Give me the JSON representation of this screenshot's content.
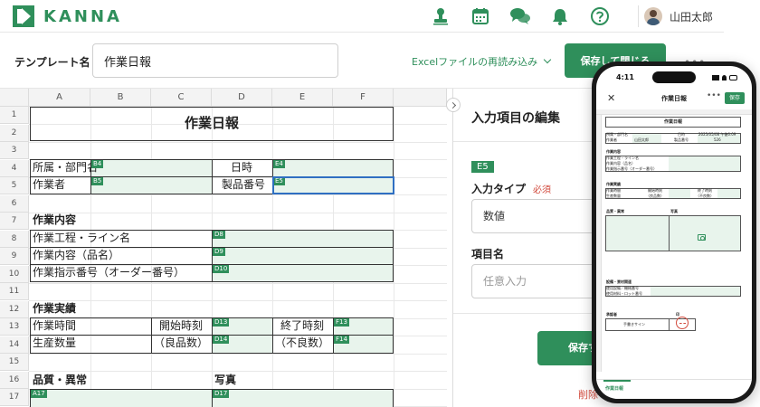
{
  "header": {
    "logo_text": "KANNA",
    "user_name": "山田太郎"
  },
  "toolbar": {
    "template_label": "テンプレート名",
    "template_value": "作業日報",
    "reload_label": "Excelファイルの再読み込み",
    "save_close_label": "保存して閉じる",
    "more": "•••"
  },
  "sheet": {
    "columns": [
      "A",
      "B",
      "C",
      "D",
      "E",
      "F"
    ],
    "rows": [
      "1",
      "2",
      "3",
      "4",
      "5",
      "6",
      "7",
      "8",
      "9",
      "10",
      "11",
      "12",
      "13",
      "14",
      "15",
      "16",
      "17"
    ],
    "title": "作業日報",
    "labels": {
      "dept": "所属・部門名",
      "worker": "作業者",
      "datetime": "日時",
      "product_no": "製品番号",
      "work_content": "作業内容",
      "process_line": "作業工程・ライン名",
      "work_item": "作業内容（品名）",
      "order_no": "作業指示番号（オーダー番号）",
      "work_result": "作業実績",
      "work_time": "作業時間",
      "start_time": "開始時刻",
      "end_time": "終了時刻",
      "quantity": "生産数量",
      "good_qty": "（良品数）",
      "defect_qty": "（不良数）",
      "quality": "品質・異常",
      "photo": "写真"
    },
    "tags": {
      "b4": "B4",
      "b5": "B5",
      "e4": "E4",
      "e5": "E5",
      "d8": "D8",
      "d9": "D9",
      "d10": "D10",
      "d13": "D13",
      "d14": "D14",
      "f13": "F13",
      "f14": "F14",
      "a17": "A17",
      "d17": "D17"
    }
  },
  "panel": {
    "title": "入力項目の編集",
    "cell_badge": "E5",
    "input_type_label": "入力タイプ",
    "required_label": "必須",
    "input_type_value": "数値",
    "item_name_label": "項目名",
    "item_name_placeholder": "任意入力",
    "save_label": "保存す",
    "delete_label": "削除"
  },
  "phone": {
    "time": "4:11",
    "title": "作業日報",
    "more": "•••",
    "save": "保存",
    "sheet_title": "作業日報",
    "dept": "所属・部門名",
    "worker": "作業者",
    "worker_value": "山田太郎",
    "datetime": "日時",
    "datetime_value": "2025/05/08 午後6:09",
    "product_no": "製品番号",
    "product_no_value": "526",
    "work_content": "作業内容",
    "process_line": "作業工程・ライン名",
    "work_item": "作業内容（品名）",
    "order_no": "作業指示番号（オーダー番号）",
    "work_result": "作業実績",
    "work_time": "作業時間",
    "start_time": "開始時刻",
    "end_time": "終了時刻",
    "quantity": "生産数量",
    "good_qty": "（良品数）",
    "defect_qty": "（不良数）",
    "quality": "品質・異常",
    "photo": "写真",
    "equipment": "設備・資材関連",
    "equipment_no": "使用設備／機械番号",
    "material_lot": "使用材料・ロット番号",
    "approver": "承認者",
    "stamp": "印",
    "handwritten": "手書きサイン",
    "bottom_tab": "作業日報"
  },
  "colors": {
    "brand_green": "#2f8f5b",
    "cell_green": "#e8f4ec",
    "selection_blue": "#2f6fc2",
    "required_red": "#d24a3d"
  },
  "icons": [
    "stamp-icon",
    "calendar-icon",
    "chat-icon",
    "bell-icon",
    "help-icon",
    "chevron-down-icon",
    "collapse-chevron-icon",
    "close-icon",
    "camera-icon"
  ]
}
